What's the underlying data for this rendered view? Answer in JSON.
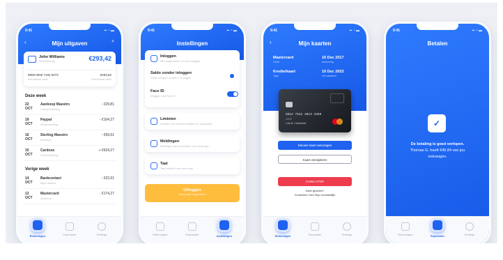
{
  "status_time": "9:41",
  "p1": {
    "title": "Mijn uitgaven",
    "account_name": "John Williams",
    "account_sub": "Zichtrekening",
    "balance": "€293,42",
    "iban": "8808 0006 7192 8273",
    "iban_sub": "Beschikbaar saldo",
    "available": "€293,82",
    "avail_label": "Beschikbaar saldo",
    "section1": "Deze week",
    "week": [
      {
        "day": "22",
        "mon": "OCT",
        "name": "Aankoop Maestro",
        "sub": "Colruyt Antwerp",
        "amount": "- €29,81"
      },
      {
        "day": "19",
        "mon": "OCT",
        "name": "Paypal",
        "sub": "Webbestelling",
        "amount": "- €104,27"
      },
      {
        "day": "16",
        "mon": "OCT",
        "name": "Sterling Maestro",
        "sub": "Delhaize",
        "amount": "- €59,61"
      },
      {
        "day": "15",
        "mon": "OCT",
        "name": "Cardoso",
        "sub": "Overschrijving",
        "amount": "+ €624,27"
      }
    ],
    "section2": "Vorige week",
    "prev": [
      {
        "day": "14",
        "mon": "OCT",
        "name": "Bankcontact",
        "sub": "Bijen Bakker",
        "amount": "- €22,61"
      },
      {
        "day": "12",
        "mon": "OCT",
        "name": "Mastercard",
        "sub": "Aankoop",
        "amount": "- €174,27"
      }
    ],
    "tabs": [
      "Rekeningen",
      "Paymaster",
      "Settings"
    ]
  },
  "p2": {
    "title": "Instellingen",
    "items": [
      {
        "name": "Inloggen",
        "sub": "Met vingerafdruk of code inloggen"
      },
      {
        "name": "Saldo zonder inloggen",
        "sub": "Saldo bekijken zonder in te loggen"
      },
      {
        "name": "Face ID",
        "sub": "Inloggen met Face ID"
      },
      {
        "name": "Limieten",
        "sub": "Limieten van kaarten bekijken en aanpassen"
      },
      {
        "name": "Meldingen",
        "sub": "Meldingen aan of uitzetten voor deze app"
      },
      {
        "name": "Taal",
        "sub": "Taal instellen voor deze app"
      }
    ],
    "logout": "Uitloggen",
    "logout_sub": "Terug naar inlogscherm",
    "tabs": [
      "Rekeningen",
      "Paymaster",
      "Instellingen"
    ]
  },
  "p3": {
    "title": "Mijn kaarten",
    "card1_name": "Mastercard",
    "card1_type": "Debit",
    "card1_date": "10 Dec 2017",
    "card1_date_sub": "Activering",
    "card2_name": "Kredietkaart",
    "card2_type": "Type",
    "card2_date": "10 Dec 2022",
    "card2_date_sub": "Vervaldatum",
    "card_number": "5612 7512 3613 3456",
    "card_exp": "12/22",
    "card_holder": "Luis M. Cardholder",
    "btn_new": "Nieuwe kaart aanvragen",
    "btn_remove": "Kaart verwijderen",
    "btn_stop": "CARD STOP",
    "lost_text": "Kaart gestolen?",
    "lost_text2": "Contacteer Card Stop onmiddellijk!",
    "tabs": [
      "Rekeningen",
      "Paymaster",
      "Settings"
    ]
  },
  "p4": {
    "title": "Betalen",
    "msg1": "De betaling is goed verlopen.",
    "msg2": "Thomas G. heeft €45.84 van jou",
    "msg3": "ontvangen.",
    "tabs": [
      "Rekeningen",
      "Paymaster",
      "Settings"
    ]
  },
  "colors": {
    "primary": "#1f62f0",
    "danger": "#ee3b4e",
    "warning": "#ffbd3e"
  }
}
